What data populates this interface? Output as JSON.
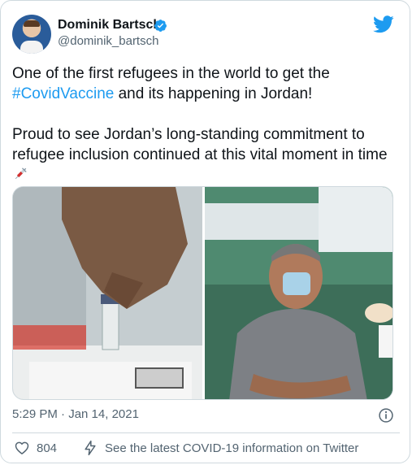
{
  "author": {
    "name": "Dominik Bartsch",
    "handle": "@dominik_bartsch"
  },
  "tweet": {
    "line1_pre": "One of the first refugees in the world to get the",
    "hashtag": "#CovidVaccine",
    "line2_post": " and its happening in Jordan!",
    "para2": "Proud to see Jordan’s long-standing commitment to refugee inclusion continued at this vital moment in time"
  },
  "timestamp": "5:29 PM · Jan 14, 2021",
  "actions": {
    "like_count": "804",
    "covid_info": "See the latest COVID-19 information on Twitter"
  },
  "colors": {
    "accent": "#1d9bf0",
    "text": "#0f1419",
    "muted": "#536471"
  },
  "icons": [
    "verified-badge-icon",
    "twitter-bird-icon",
    "syringe-icon",
    "info-icon",
    "heart-icon",
    "lightning-icon"
  ]
}
